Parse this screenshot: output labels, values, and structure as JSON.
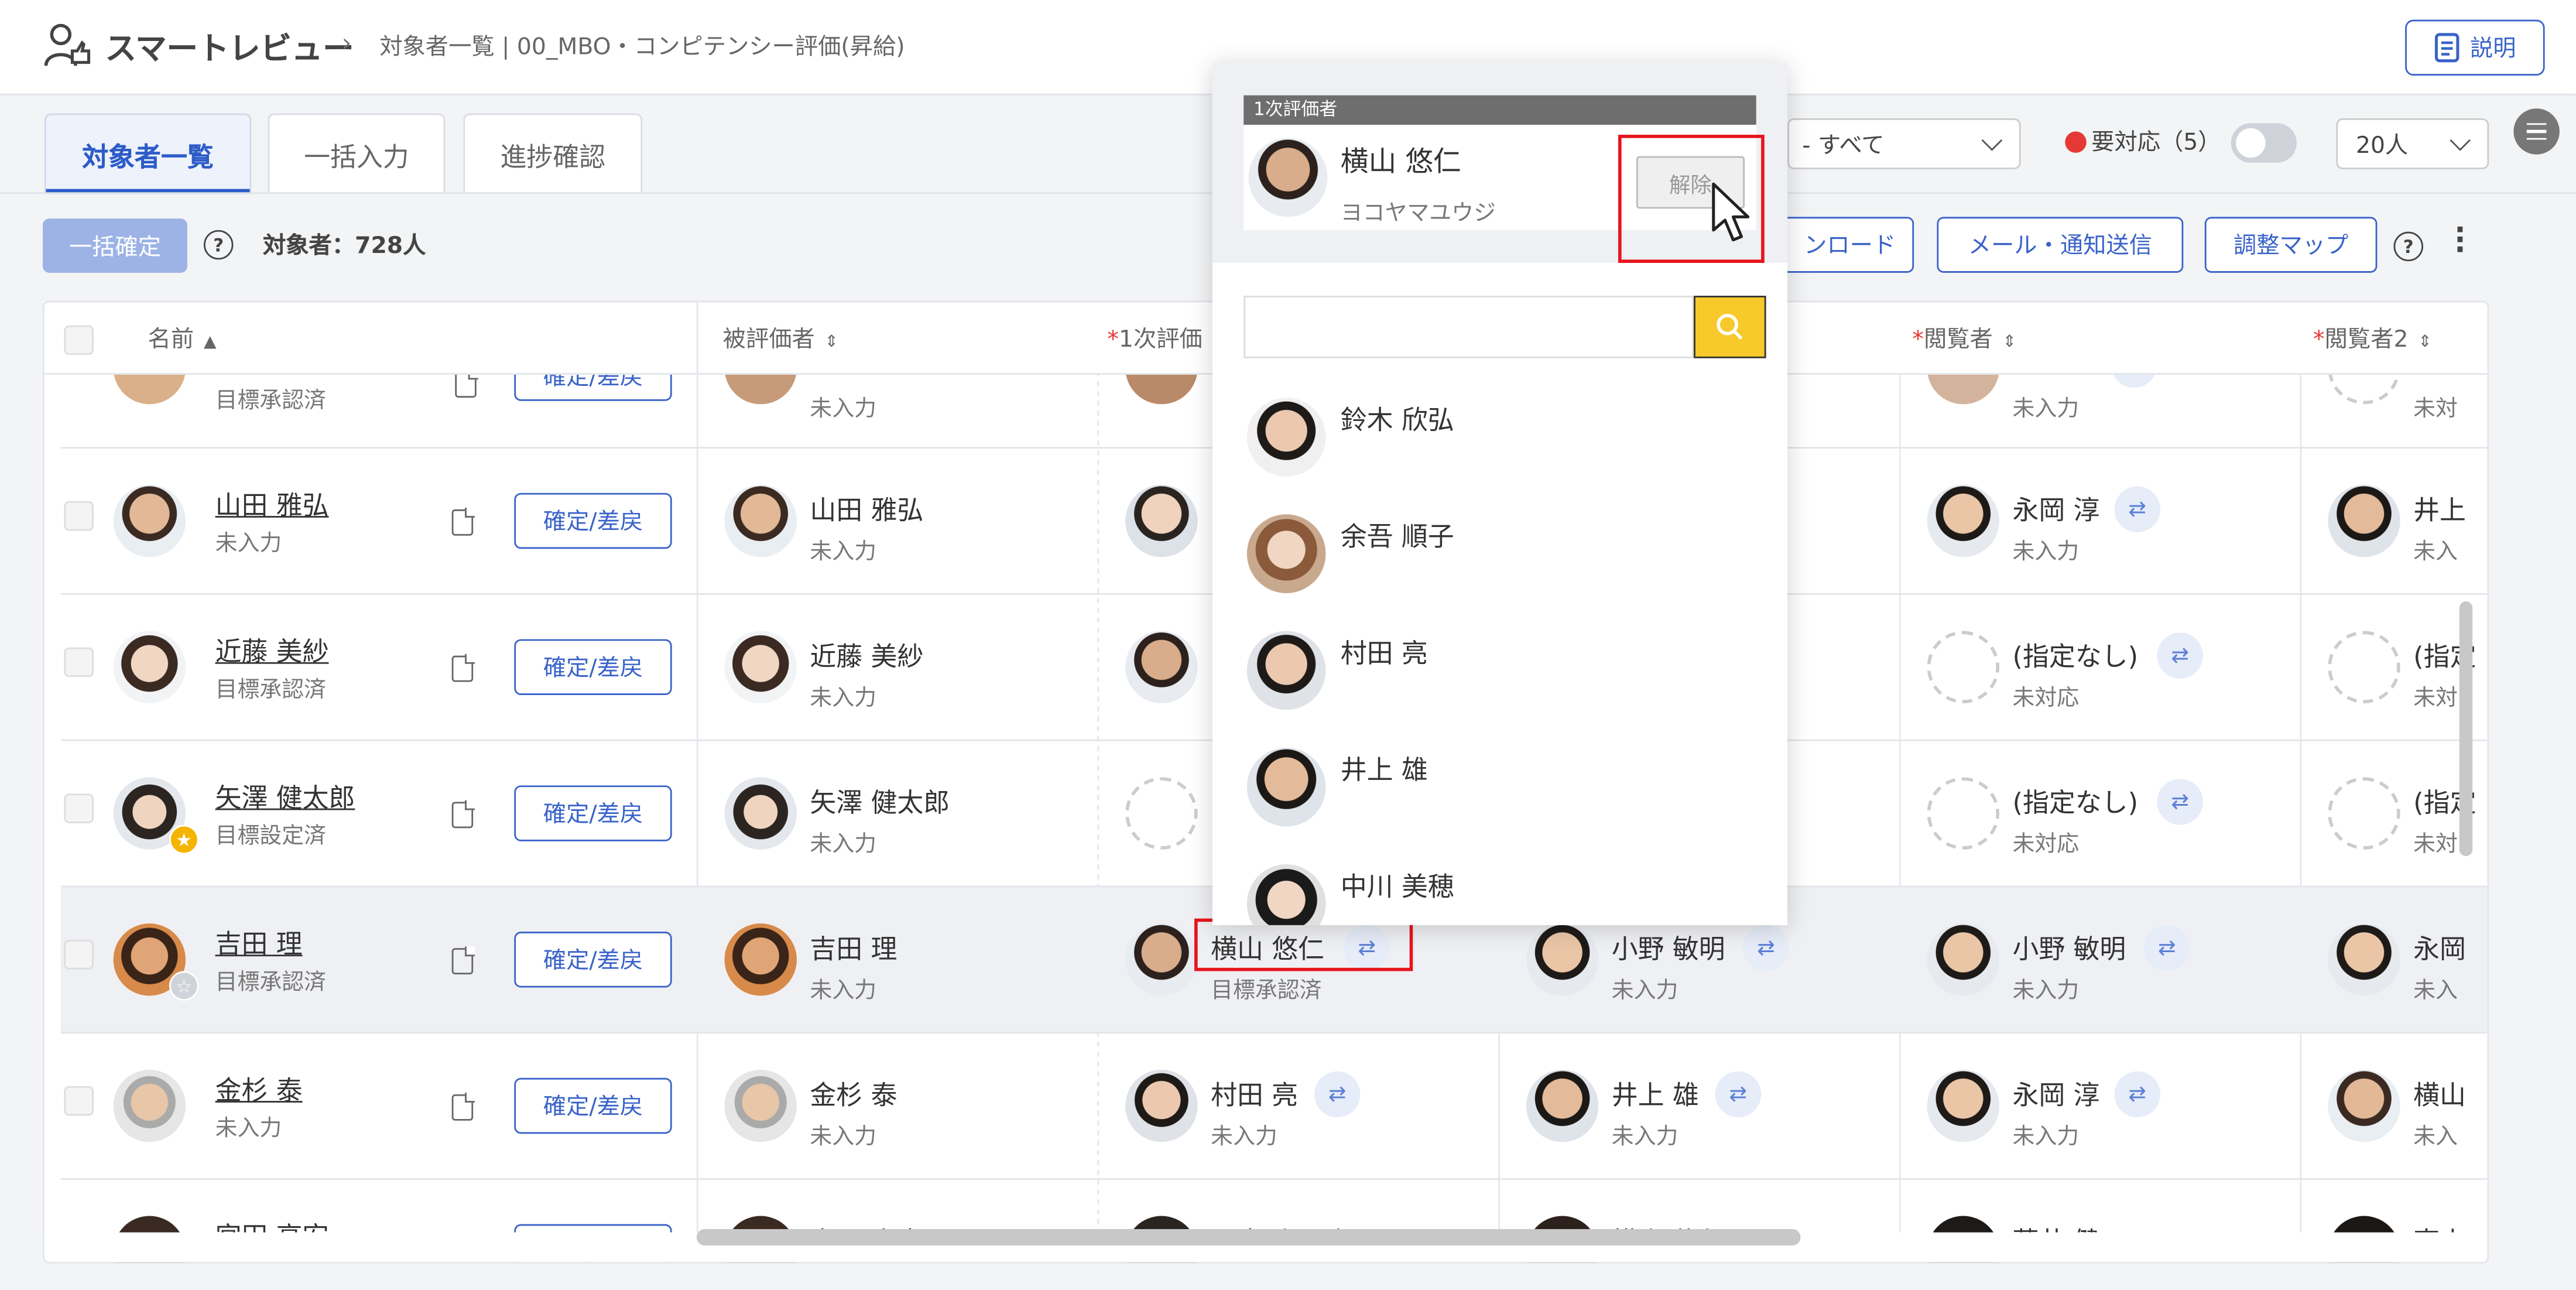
{
  "header": {
    "app_name": "スマートレビュー",
    "breadcrumb_sep": "›",
    "breadcrumb": "対象者一覧 | 00_MBO・コンピテンシー評価(昇給)",
    "help_label": "説明"
  },
  "tabs": [
    {
      "label": "対象者一覧",
      "active": true
    },
    {
      "label": "一括入力",
      "active": false
    },
    {
      "label": "進捗確認",
      "active": false
    }
  ],
  "toolbar": {
    "bulk_confirm": "一括確定",
    "target_count": "対象者：728人",
    "download": "ンロード",
    "mail": "メール・通知送信",
    "adjust_map": "調整マップ",
    "filter_all": "- すべて",
    "needs_action": "要対応（5）",
    "per_page": "20人"
  },
  "columns": {
    "name": "名前",
    "evaluatee": "被評価者",
    "first_evaluator": "1次評価",
    "viewer": "閲覧者",
    "viewer2": "閲覧者2"
  },
  "rows": [
    {
      "name": "",
      "status": "目標承認済",
      "evaluatee": "",
      "eval_status": "未入力",
      "viewer": "",
      "viewer_status": "未入力",
      "viewer2": "",
      "viewer2_status": "未対"
    },
    {
      "name": "山田 雅弘",
      "status": "未入力",
      "evaluatee": "山田 雅弘",
      "eval_status": "未入力",
      "viewer": "永岡 淳",
      "viewer_status": "未入力",
      "viewer2": "井上",
      "viewer2_status": "未入"
    },
    {
      "name": "近藤 美紗",
      "status": "目標承認済",
      "evaluatee": "近藤 美紗",
      "eval_status": "未入力",
      "viewer": "(指定なし)",
      "viewer_status": "未対応",
      "viewer2": "(指定",
      "viewer2_status": "未対"
    },
    {
      "name": "矢澤 健太郎",
      "status": "目標設定済",
      "evaluatee": "矢澤 健太郎",
      "eval_status": "未入力",
      "viewer": "(指定なし)",
      "viewer_status": "未対応",
      "viewer2": "(指定",
      "viewer2_status": "未対"
    },
    {
      "name": "吉田 理",
      "status": "目標承認済",
      "evaluatee": "吉田 理",
      "eval_status": "未入力",
      "first": "横山 悠仁",
      "first_status": "目標承認済",
      "second": "小野 敏明",
      "second_status": "未入力",
      "viewer": "小野 敏明",
      "viewer_status": "未入力",
      "viewer2": "永岡",
      "viewer2_status": "未入"
    },
    {
      "name": "金杉 泰",
      "status": "未入力",
      "evaluatee": "金杉 泰",
      "eval_status": "未入力",
      "first": "村田 亮",
      "first_status": "未入力",
      "second": "井上 雄",
      "second_status": "未入力",
      "viewer": "永岡 淳",
      "viewer_status": "未入力",
      "viewer2": "横山",
      "viewer2_status": "未入"
    },
    {
      "name": "宮田 高宏",
      "evaluatee": "宮田 高宏",
      "first": "関光 小百合",
      "second": "横山 悠仁",
      "viewer": "藤井 健",
      "viewer2": "東山"
    }
  ],
  "confirm_label": "確定/差戻",
  "popup": {
    "section_label": "1次評価者",
    "current_name": "横山 悠仁",
    "current_kana": "ヨコヤマユウジ",
    "release": "解除",
    "search_placeholder": "",
    "candidates": [
      "鈴木 欣弘",
      "余吾 順子",
      "村田 亮",
      "井上 雄",
      "中川 美穂"
    ]
  },
  "colors": {
    "accent": "#3a63c9",
    "alert": "#e53935",
    "highlight_box": "#e8141c",
    "search_button": "#f7c92a"
  }
}
